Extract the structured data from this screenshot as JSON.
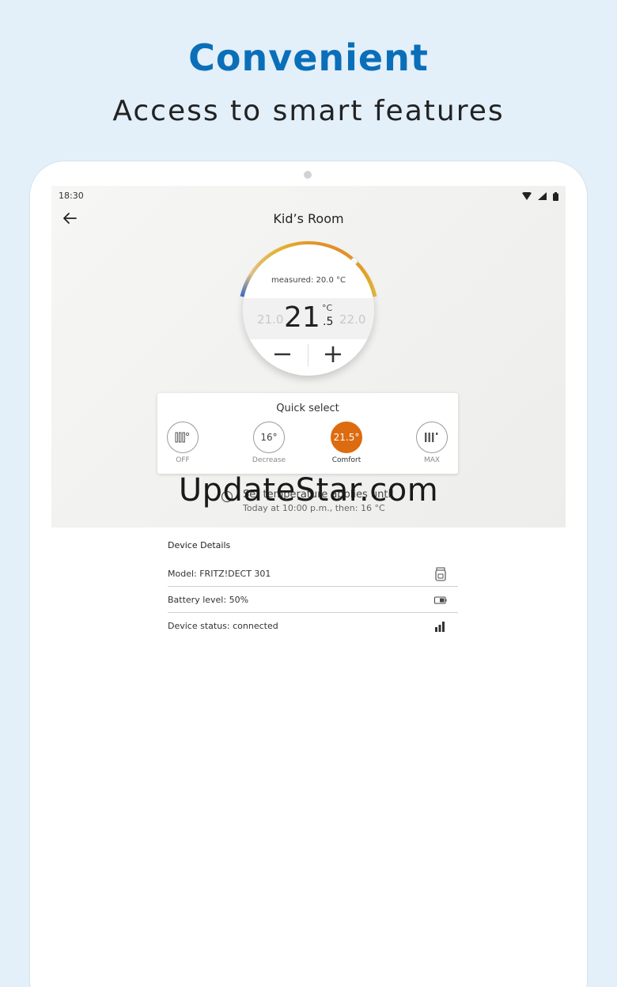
{
  "promo": {
    "title": "Convenient",
    "subtitle": "Access to smart features"
  },
  "status_bar": {
    "time": "18:30",
    "icons": [
      "wifi-icon",
      "signal-icon",
      "battery-icon"
    ]
  },
  "header": {
    "title": "Kid’s Room",
    "back_icon": "arrow-left-icon"
  },
  "thermostat": {
    "measured": "measured: 20.0 °C",
    "prev_value": "21.0",
    "next_value": "22.0",
    "current_whole": "21",
    "current_decimal": ".5",
    "unit": "°C",
    "minus": "−",
    "plus": "+"
  },
  "quick_select": {
    "title": "Quick select",
    "items": [
      {
        "glyph": "",
        "label": "OFF",
        "icon": "radiator-off-icon",
        "active": false
      },
      {
        "glyph": "16°",
        "label": "Decrease",
        "active": false
      },
      {
        "glyph": "21.5°",
        "label": "Comfort",
        "active": true
      },
      {
        "glyph": "",
        "label": "MAX",
        "icon": "radiator-max-icon",
        "active": false
      }
    ],
    "accent": "#dd6b10"
  },
  "schedule_info": {
    "line1": "Set temperature applies until",
    "line2": "Today at 10:00 p.m., then: 16 °C",
    "icon": "clock-icon"
  },
  "watermark": "UpdateStar.com",
  "device_details": {
    "title": "Device Details",
    "rows": [
      {
        "text": "Model: FRITZ!DECT 301",
        "icon": "thermostat-device-icon"
      },
      {
        "text": "Battery level: 50%",
        "icon": "battery-half-icon"
      },
      {
        "text": "Device status: connected",
        "icon": "signal-bars-icon"
      }
    ]
  },
  "colors": {
    "brand_blue": "#0a6fb8",
    "background": "#e3eff9"
  }
}
